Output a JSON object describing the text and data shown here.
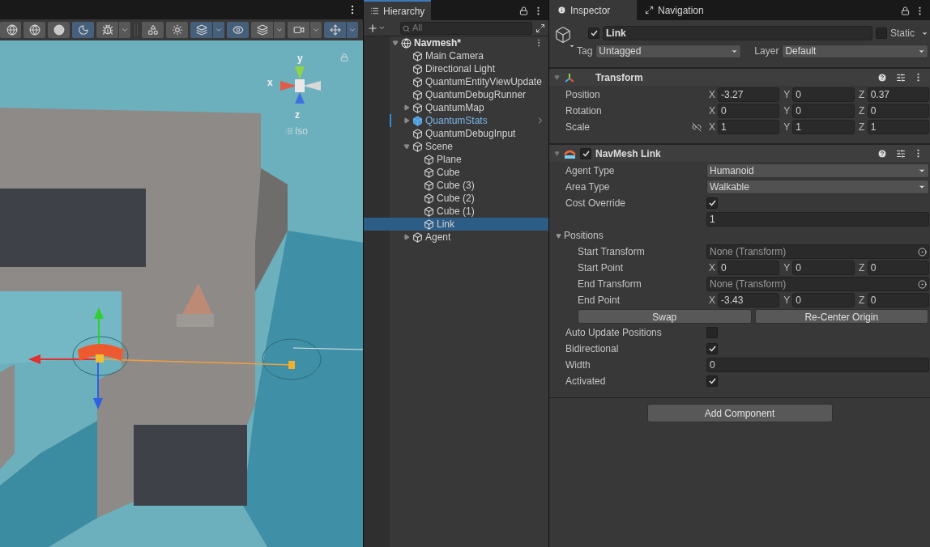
{
  "scene_view": {
    "toolbar": [
      {
        "selected": false,
        "dropdown": false
      },
      {
        "selected": false,
        "dropdown": false
      },
      {
        "selected": false,
        "dropdown": false
      },
      {
        "selected": true,
        "dropdown": false
      },
      {
        "selected": false,
        "dropdown": true
      },
      {
        "selected": false,
        "dropdown": false
      },
      {
        "selected": false,
        "dropdown": false
      },
      {
        "selected": true,
        "dropdown": true
      },
      {
        "selected": true,
        "dropdown": false
      },
      {
        "selected": false,
        "dropdown": true
      },
      {
        "selected": false,
        "dropdown": true
      },
      {
        "selected": true,
        "dropdown": true
      }
    ],
    "gizmo": {
      "x_label": "x",
      "y_label": "y",
      "z_label": "z",
      "projection": "Iso"
    }
  },
  "hierarchy": {
    "tab": "Hierarchy",
    "search": {
      "placeholder": "All"
    },
    "tree": [
      {
        "label": "Navmesh*",
        "kind": "scene",
        "expanded": true,
        "selected": false,
        "children": [
          {
            "label": "Main Camera",
            "kind": "object",
            "selected": false
          },
          {
            "label": "Directional Light",
            "kind": "object",
            "selected": false
          },
          {
            "label": "QuantumEntityViewUpdate",
            "kind": "object",
            "selected": false
          },
          {
            "label": "QuantumDebugRunner",
            "kind": "object",
            "selected": false
          },
          {
            "label": "QuantumMap",
            "kind": "object",
            "expanded": false,
            "selected": false
          },
          {
            "label": "QuantumStats",
            "kind": "prefab",
            "expanded": false,
            "selected": false
          },
          {
            "label": "QuantumDebugInput",
            "kind": "object",
            "selected": false
          },
          {
            "label": "Scene",
            "kind": "object",
            "expanded": true,
            "selected": false,
            "children": [
              {
                "label": "Plane",
                "kind": "object",
                "selected": false
              },
              {
                "label": "Cube",
                "kind": "object",
                "selected": false
              },
              {
                "label": "Cube (3)",
                "kind": "object",
                "selected": false
              },
              {
                "label": "Cube (2)",
                "kind": "object",
                "selected": false
              },
              {
                "label": "Cube (1)",
                "kind": "object",
                "selected": false
              },
              {
                "label": "Link",
                "kind": "object",
                "selected": true
              }
            ]
          },
          {
            "label": "Agent",
            "kind": "object",
            "expanded": false,
            "selected": false
          }
        ]
      }
    ]
  },
  "inspector": {
    "tabs": [
      {
        "label": "Inspector",
        "selected": true
      },
      {
        "label": "Navigation",
        "selected": false
      }
    ],
    "object": {
      "active": true,
      "name": "Link",
      "static_label": "Static",
      "static": false,
      "tag_label": "Tag",
      "tag": "Untagged",
      "layer_label": "Layer",
      "layer": "Default"
    },
    "components": [
      {
        "title": "Transform",
        "kind": "transform",
        "expanded": true,
        "rows": [
          {
            "kind": "vector",
            "label": "Position",
            "constraint_icon": false,
            "values": [
              {
                "axis": "X",
                "value": "-3.27"
              },
              {
                "axis": "Y",
                "value": "0"
              },
              {
                "axis": "Z",
                "value": "0.37"
              }
            ]
          },
          {
            "kind": "vector",
            "label": "Rotation",
            "constraint_icon": false,
            "values": [
              {
                "axis": "X",
                "value": "0"
              },
              {
                "axis": "Y",
                "value": "0"
              },
              {
                "axis": "Z",
                "value": "0"
              }
            ]
          },
          {
            "kind": "vector",
            "label": "Scale",
            "constraint_icon": true,
            "values": [
              {
                "axis": "X",
                "value": "1"
              },
              {
                "axis": "Y",
                "value": "1"
              },
              {
                "axis": "Z",
                "value": "1"
              }
            ]
          }
        ]
      },
      {
        "title": "NavMesh Link",
        "kind": "behaviour",
        "expanded": true,
        "enabled": true,
        "rows": [
          {
            "kind": "dropdown",
            "label": "Agent Type",
            "value": "Humanoid"
          },
          {
            "kind": "dropdown",
            "label": "Area Type",
            "value": "Walkable"
          },
          {
            "kind": "checkbox",
            "label": "Cost Override",
            "checked": true
          },
          {
            "kind": "number",
            "value": "1"
          },
          {
            "kind": "foldout",
            "label": "Positions",
            "expanded": true,
            "children": [
              {
                "kind": "object",
                "label": "Start Transform",
                "value": "None (Transform)"
              },
              {
                "kind": "vector",
                "label": "Start Point",
                "constraint_icon": false,
                "values": [
                  {
                    "axis": "X",
                    "value": "0"
                  },
                  {
                    "axis": "Y",
                    "value": "0"
                  },
                  {
                    "axis": "Z",
                    "value": "0"
                  }
                ]
              },
              {
                "kind": "object",
                "label": "End Transform",
                "value": "None (Transform)"
              },
              {
                "kind": "vector",
                "label": "End Point",
                "constraint_icon": false,
                "values": [
                  {
                    "axis": "X",
                    "value": "-3.43"
                  },
                  {
                    "axis": "Y",
                    "value": "0"
                  },
                  {
                    "axis": "Z",
                    "value": "0"
                  }
                ]
              },
              {
                "kind": "buttons",
                "buttons": [
                  "Swap",
                  "Re-Center Origin"
                ]
              }
            ]
          },
          {
            "kind": "checkbox",
            "label": "Auto Update Positions",
            "checked": false
          },
          {
            "kind": "checkbox",
            "label": "Bidirectional",
            "checked": true
          },
          {
            "kind": "number",
            "label": "Width",
            "value": "0"
          },
          {
            "kind": "checkbox",
            "label": "Activated",
            "checked": true
          }
        ]
      }
    ],
    "add_component": "Add Component"
  }
}
